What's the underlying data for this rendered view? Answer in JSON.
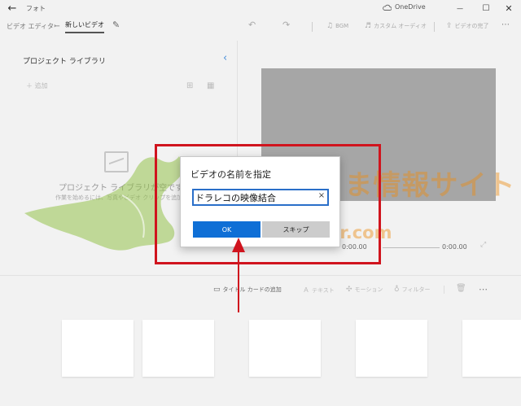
{
  "app": {
    "title": "フォト",
    "onedrive_label": "OneDrive",
    "back_glyph": "←",
    "minimize_glyph": "—",
    "maximize_glyph": "☐",
    "close_glyph": "✕"
  },
  "toolbar": {
    "breadcrumb": "ビデオ エディター",
    "breadcrumb_sep": "›",
    "project_name": "新しいビデオ",
    "pencil_glyph": "✎",
    "undo_glyph": "↶",
    "redo_glyph": "↷",
    "bgm_label": "BGM",
    "custom_audio_label": "カスタム オーディオ",
    "finish_video_label": "ビデオの完了"
  },
  "library": {
    "title": "プロジェクト ライブラリ",
    "chevron_glyph": "‹",
    "add_label": "＋ 追加",
    "empty_main": "プロジェクト ライブラリが空です",
    "empty_sub": "作業を始めるには、写真やビデオ クリップを追加してください"
  },
  "preview": {
    "time_start": "0:00.00",
    "time_end": "0:00.00"
  },
  "storyboard": {
    "title_card_label": "タイトル カードの追加",
    "text_label": "テキスト",
    "motion_label": "モーション",
    "filter_label": "フィルター",
    "more_glyph": "⋯"
  },
  "dialog": {
    "title": "ビデオの名前を指定",
    "name_value": "ドラレコの映像結合",
    "clear_glyph": "×",
    "ok_label": "OK",
    "skip_label": "スキップ"
  },
  "watermark": {
    "text": "北陸くるま情報サイト",
    "url": "hokurikucar.com"
  },
  "colors": {
    "accent": "#0f6fd6",
    "highlight_frame": "#d0141e",
    "watermark_orange": "#eb8c14",
    "watermark_green": "#8cbe3c"
  }
}
